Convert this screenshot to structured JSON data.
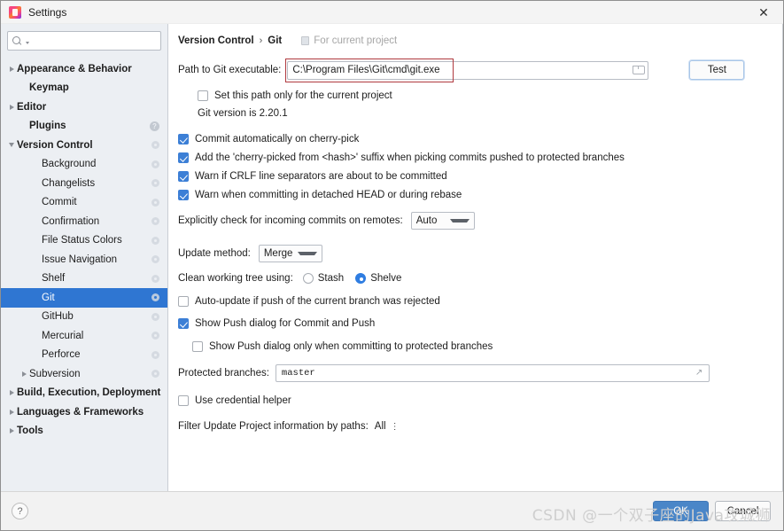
{
  "window": {
    "title": "Settings",
    "app_icon": "intellij-idea-icon",
    "close_icon": "close-icon"
  },
  "sidebar": {
    "search": {
      "value": "",
      "placeholder": "",
      "icon": "search-icon"
    },
    "items": [
      {
        "label": "Appearance & Behavior",
        "bold": true,
        "indent": 0,
        "arrow": "closed",
        "badge": "none",
        "selected": false
      },
      {
        "label": "Keymap",
        "bold": true,
        "indent": 1,
        "arrow": "none",
        "badge": "none",
        "selected": false
      },
      {
        "label": "Editor",
        "bold": true,
        "indent": 0,
        "arrow": "closed",
        "badge": "none",
        "selected": false
      },
      {
        "label": "Plugins",
        "bold": true,
        "indent": 1,
        "arrow": "none",
        "badge": "help",
        "selected": false
      },
      {
        "label": "Version Control",
        "bold": true,
        "indent": 0,
        "arrow": "open",
        "badge": "gear",
        "selected": false
      },
      {
        "label": "Background",
        "bold": false,
        "indent": 2,
        "arrow": "none",
        "badge": "gear",
        "selected": false
      },
      {
        "label": "Changelists",
        "bold": false,
        "indent": 2,
        "arrow": "none",
        "badge": "gear",
        "selected": false
      },
      {
        "label": "Commit",
        "bold": false,
        "indent": 2,
        "arrow": "none",
        "badge": "gear",
        "selected": false
      },
      {
        "label": "Confirmation",
        "bold": false,
        "indent": 2,
        "arrow": "none",
        "badge": "gear",
        "selected": false
      },
      {
        "label": "File Status Colors",
        "bold": false,
        "indent": 2,
        "arrow": "none",
        "badge": "gear",
        "selected": false
      },
      {
        "label": "Issue Navigation",
        "bold": false,
        "indent": 2,
        "arrow": "none",
        "badge": "gear",
        "selected": false
      },
      {
        "label": "Shelf",
        "bold": false,
        "indent": 2,
        "arrow": "none",
        "badge": "gear",
        "selected": false
      },
      {
        "label": "Git",
        "bold": false,
        "indent": 2,
        "arrow": "none",
        "badge": "gear",
        "selected": true
      },
      {
        "label": "GitHub",
        "bold": false,
        "indent": 2,
        "arrow": "none",
        "badge": "gear",
        "selected": false
      },
      {
        "label": "Mercurial",
        "bold": false,
        "indent": 2,
        "arrow": "none",
        "badge": "gear",
        "selected": false
      },
      {
        "label": "Perforce",
        "bold": false,
        "indent": 2,
        "arrow": "none",
        "badge": "gear",
        "selected": false
      },
      {
        "label": "Subversion",
        "bold": false,
        "indent": 1,
        "arrow": "closed",
        "badge": "gear",
        "selected": false
      },
      {
        "label": "Build, Execution, Deployment",
        "bold": true,
        "indent": 0,
        "arrow": "closed",
        "badge": "none",
        "selected": false
      },
      {
        "label": "Languages & Frameworks",
        "bold": true,
        "indent": 0,
        "arrow": "closed",
        "badge": "none",
        "selected": false
      },
      {
        "label": "Tools",
        "bold": true,
        "indent": 0,
        "arrow": "closed",
        "badge": "none",
        "selected": false
      }
    ]
  },
  "main": {
    "breadcrumb": {
      "parent": "Version Control",
      "separator": "›",
      "current": "Git"
    },
    "for_current_project": {
      "label": "For current project",
      "icon": "project-icon"
    },
    "path": {
      "label": "Path to Git executable:",
      "value": "C:\\Program Files\\Git\\cmd\\git.exe",
      "placeholder": "",
      "browse_icon": "folder-icon",
      "test_button": "Test",
      "annotation_color": "#b03a3f"
    },
    "set_path_only": {
      "label": "Set this path only for the current project",
      "checked": false
    },
    "git_version": "Git version is 2.20.1",
    "checks": [
      {
        "label": "Commit automatically on cherry-pick",
        "checked": true
      },
      {
        "label": "Add the 'cherry-picked from <hash>' suffix when picking commits pushed to protected branches",
        "checked": true
      },
      {
        "label": "Warn if CRLF line separators are about to be committed",
        "checked": true
      },
      {
        "label": "Warn when committing in detached HEAD or during rebase",
        "checked": true
      }
    ],
    "incoming": {
      "label": "Explicitly check for incoming commits on remotes:",
      "value": "Auto"
    },
    "update_method": {
      "label": "Update method:",
      "value": "Merge"
    },
    "clean_tree": {
      "label": "Clean working tree using:",
      "options": [
        "Stash",
        "Shelve"
      ],
      "selected": "Shelve"
    },
    "auto_update": {
      "label": "Auto-update if push of the current branch was rejected",
      "checked": false
    },
    "show_push": {
      "label": "Show Push dialog for Commit and Push",
      "checked": true
    },
    "show_push_protected": {
      "label": "Show Push dialog only when committing to protected branches",
      "checked": false
    },
    "protected_branches": {
      "label": "Protected branches:",
      "value": "master",
      "expand_icon": "expand-icon"
    },
    "credential_helper": {
      "label": "Use credential helper",
      "checked": false
    },
    "filter_paths": {
      "label": "Filter Update Project information by paths:",
      "value": "All"
    }
  },
  "footer": {
    "help_icon": "?",
    "ok_label": "OK",
    "cancel_label": "Cancel"
  },
  "watermark": "CSDN @一个双子座的Java攻城狮",
  "colors": {
    "accent": "#2f76d2",
    "checkbox": "#3c7fd6",
    "annotation": "#b03a3f",
    "sidebar_bg": "#eceff3"
  }
}
